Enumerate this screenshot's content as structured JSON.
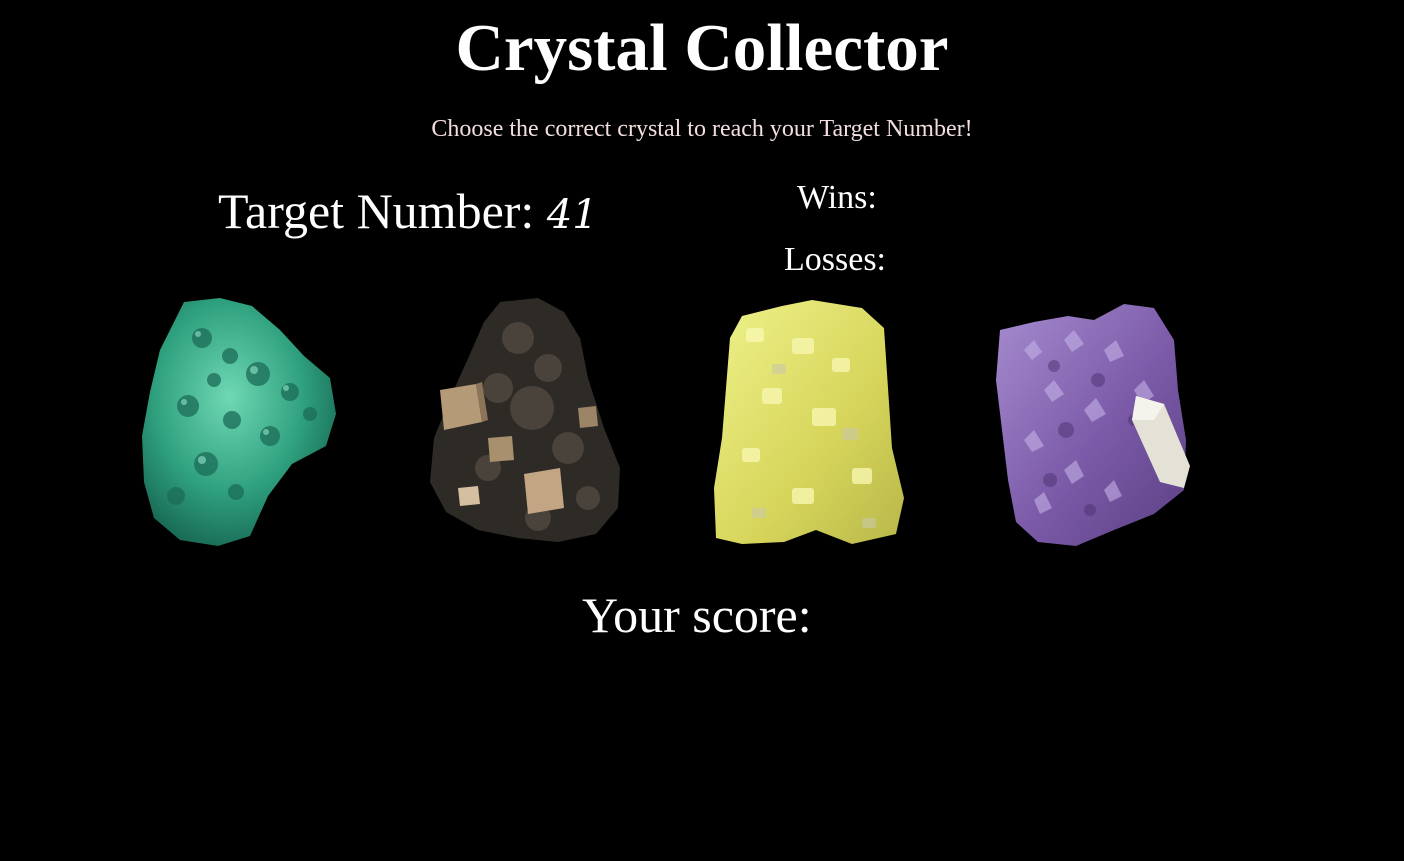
{
  "header": {
    "title": "Crystal Collector",
    "subtitle": "Choose the correct crystal to reach your Target Number!"
  },
  "stats": {
    "target_label": "Target Number: ",
    "target_value": "41",
    "wins_label": "Wins:",
    "losses_label": "Losses:"
  },
  "crystals": [
    {
      "name": "green crystal",
      "color": "#3fae8e"
    },
    {
      "name": "brown crystal",
      "color": "#3a342e"
    },
    {
      "name": "yellow crystal",
      "color": "#dfe06a"
    },
    {
      "name": "purple crystal",
      "color": "#8c6fb8"
    }
  ],
  "score": {
    "label": "Your score:"
  }
}
